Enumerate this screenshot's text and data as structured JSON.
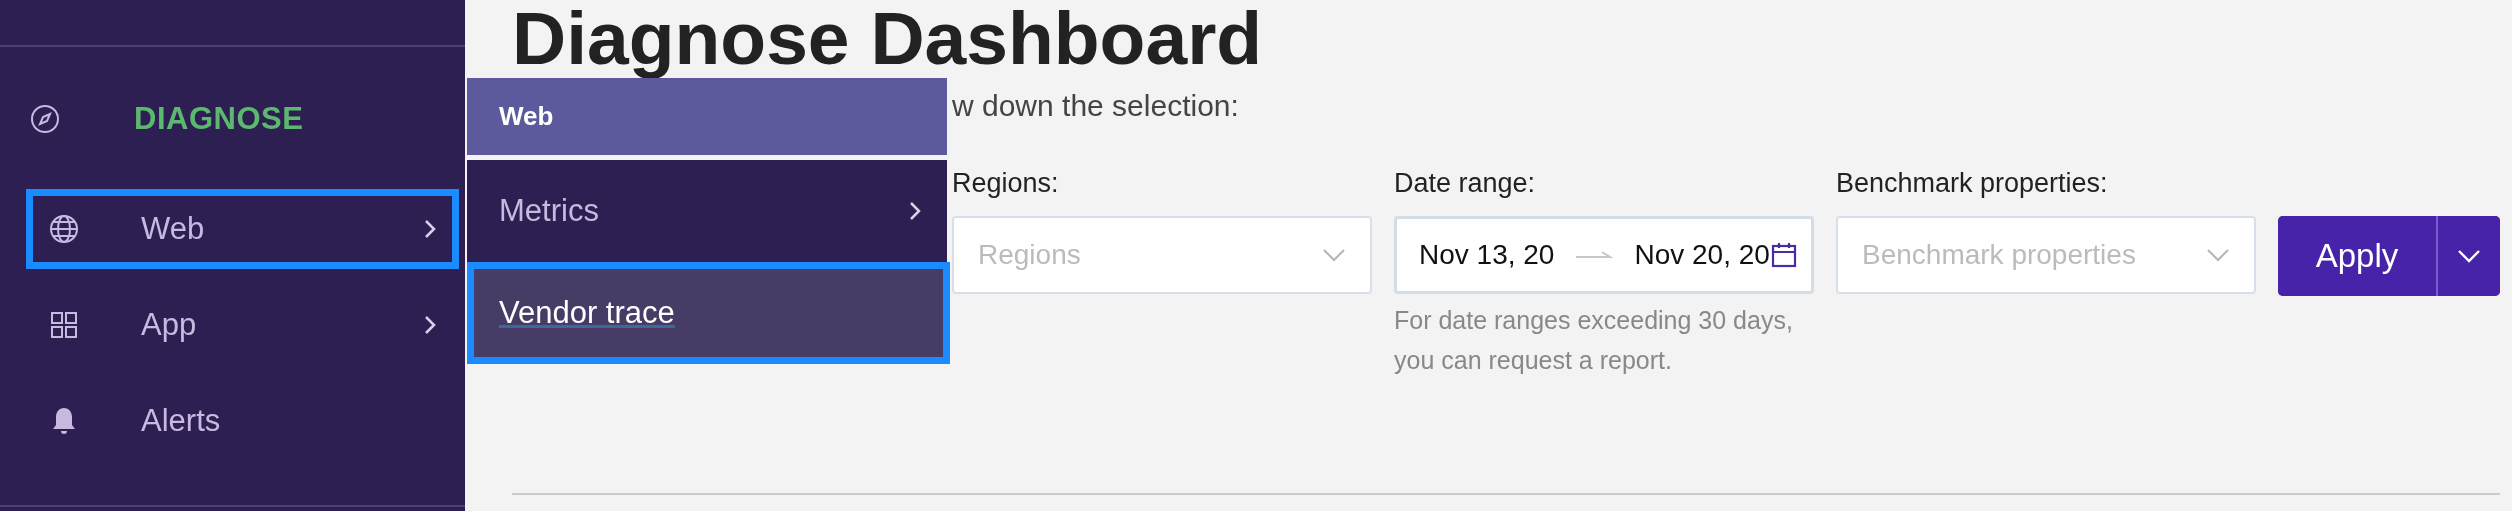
{
  "sidebar": {
    "section": {
      "label": "DIAGNOSE"
    },
    "items": [
      {
        "label": "Web",
        "has_submenu": true,
        "focused": true
      },
      {
        "label": "App",
        "has_submenu": true,
        "focused": false
      },
      {
        "label": "Alerts",
        "has_submenu": false,
        "focused": false
      }
    ]
  },
  "flyout": {
    "header": "Web",
    "items": [
      {
        "label": "Metrics",
        "has_submenu": true,
        "focused": false
      },
      {
        "label": "Vendor trace",
        "has_submenu": false,
        "focused": true
      }
    ]
  },
  "page": {
    "title": "Diagnose Dashboard",
    "subtitle": "w down the selection:"
  },
  "filters": [
    {
      "kind": "select",
      "label": "Regions:",
      "placeholder": "Regions"
    },
    {
      "kind": "daterange",
      "label": "Date range:",
      "start": "Nov 13, 20",
      "end": "Nov 20, 20",
      "hint": "For date ranges exceeding 30 days, you can request a report."
    },
    {
      "kind": "select",
      "label": "Benchmark properties:",
      "placeholder": "Benchmark properties"
    }
  ],
  "apply_button": {
    "label": "Apply"
  }
}
